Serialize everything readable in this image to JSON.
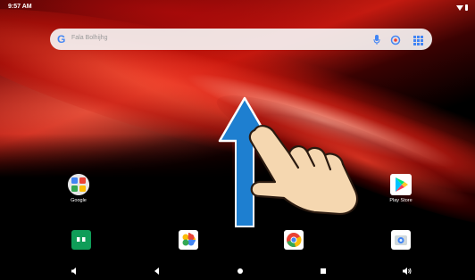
{
  "status_bar": {
    "time": "9:57 AM"
  },
  "search": {
    "logo": "G",
    "placeholder": "Fala Bolhijhg"
  },
  "home_apps": [
    {
      "label": "Google",
      "icon": "google-folder-icon"
    },
    {
      "label": "Play Store",
      "icon": "play-store-icon"
    }
  ],
  "dock": [
    {
      "icon": "hangouts-icon"
    },
    {
      "icon": "photos-icon"
    },
    {
      "icon": "chrome-icon"
    },
    {
      "icon": "camera-icon"
    }
  ],
  "nav_bar": {
    "items": [
      "volume-down-icon",
      "back-icon",
      "home-icon",
      "recents-icon",
      "volume-up-icon"
    ]
  },
  "overlay": {
    "gesture": "swipe-up",
    "arrow_color": "#1e7fd0",
    "hand_color": "#f5d7b0"
  }
}
